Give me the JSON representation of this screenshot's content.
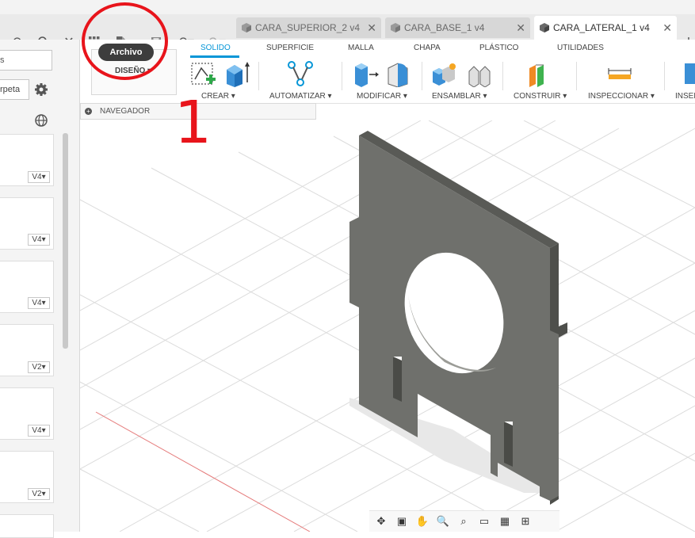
{
  "tabs": [
    {
      "label": "CARA_SUPERIOR_2 v4",
      "active": false
    },
    {
      "label": "CARA_BASE_1 v4",
      "active": false
    },
    {
      "label": "CARA_LATERAL_1 v4",
      "active": true
    }
  ],
  "header": {
    "tooltip_archivo": "Archivo",
    "workspace_label": "DISEÑO",
    "add_tab_icon": "plus-icon"
  },
  "left_panel": {
    "search_fragment": "s",
    "folder_button_fragment": "rpeta",
    "versions": [
      "V4",
      "V4",
      "V4",
      "V2",
      "V4",
      "V2"
    ]
  },
  "ribbon": {
    "tabs": [
      "SOLIDO",
      "SUPERFICIE",
      "MALLA",
      "CHAPA",
      "PLÁSTICO",
      "UTILIDADES"
    ],
    "active_tab": "SOLIDO",
    "groups": [
      "CREAR",
      "AUTOMATIZAR",
      "MODIFICAR",
      "ENSAMBLAR",
      "CONSTRUIR",
      "INSPECCIONAR",
      "INSER"
    ]
  },
  "navigator": {
    "label": "NAVEGADOR"
  },
  "annotation": {
    "number": "1",
    "color": "#e8141b"
  },
  "colors": {
    "accent": "#0696d7",
    "part": "#6f706c",
    "grid": "#dcdcdc"
  }
}
